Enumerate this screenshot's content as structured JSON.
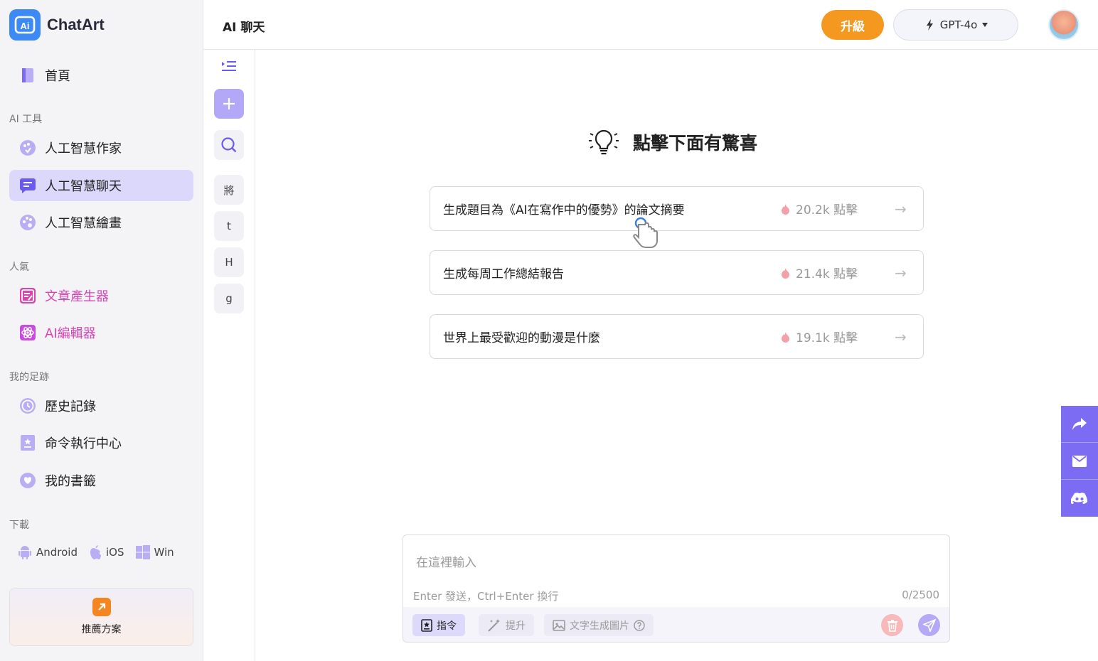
{
  "app": {
    "name": "ChatArt"
  },
  "sidebar": {
    "home": "首頁",
    "sections": {
      "ai_tools": "AI 工具",
      "popular": "人氣",
      "footprint": "我的足跡",
      "download": "下載"
    },
    "ai_tools": [
      {
        "label": "人工智慧作家",
        "icon": "palette-icon"
      },
      {
        "label": "人工智慧聊天",
        "icon": "chat-icon",
        "active": true
      },
      {
        "label": "人工智慧繪畫",
        "icon": "paint-icon"
      }
    ],
    "popular": [
      {
        "label": "文章產生器",
        "icon": "article-icon"
      },
      {
        "label": "AI編輯器",
        "icon": "atom-icon"
      }
    ],
    "footprint": [
      {
        "label": "歷史記錄",
        "icon": "clock-icon"
      },
      {
        "label": "命令執行中心",
        "icon": "command-icon"
      },
      {
        "label": "我的書籤",
        "icon": "heart-icon"
      }
    ],
    "downloads": {
      "android": "Android",
      "ios": "iOS",
      "win": "Win"
    },
    "plan": {
      "label": "推薦方案"
    }
  },
  "header": {
    "title": "AI 聊天",
    "upgrade": "升級",
    "model": "GPT-4o"
  },
  "rail": {
    "history_initials": [
      "將",
      "t",
      "H",
      "g"
    ]
  },
  "main": {
    "headline": "點擊下面有驚喜",
    "suggestions": [
      {
        "text": "生成題目為《AI在寫作中的優勢》的論文摘要",
        "clicks": "20.2k 點擊"
      },
      {
        "text": "生成每周工作總結報告",
        "clicks": "21.4k 點擊"
      },
      {
        "text": "世界上最受歡迎的動漫是什麼",
        "clicks": "19.1k 點擊"
      }
    ]
  },
  "composer": {
    "placeholder": "在這裡輸入",
    "hint": "Enter 發送，Ctrl+Enter 換行",
    "count": "0/2500",
    "tools": {
      "command": "指令",
      "enhance": "提升",
      "text_to_image": "文字生成圖片"
    }
  },
  "colors": {
    "accent": "#7b6cf3",
    "upgrade": "#f59820",
    "logo": "#3d8af7",
    "pink": "#d646b3"
  }
}
